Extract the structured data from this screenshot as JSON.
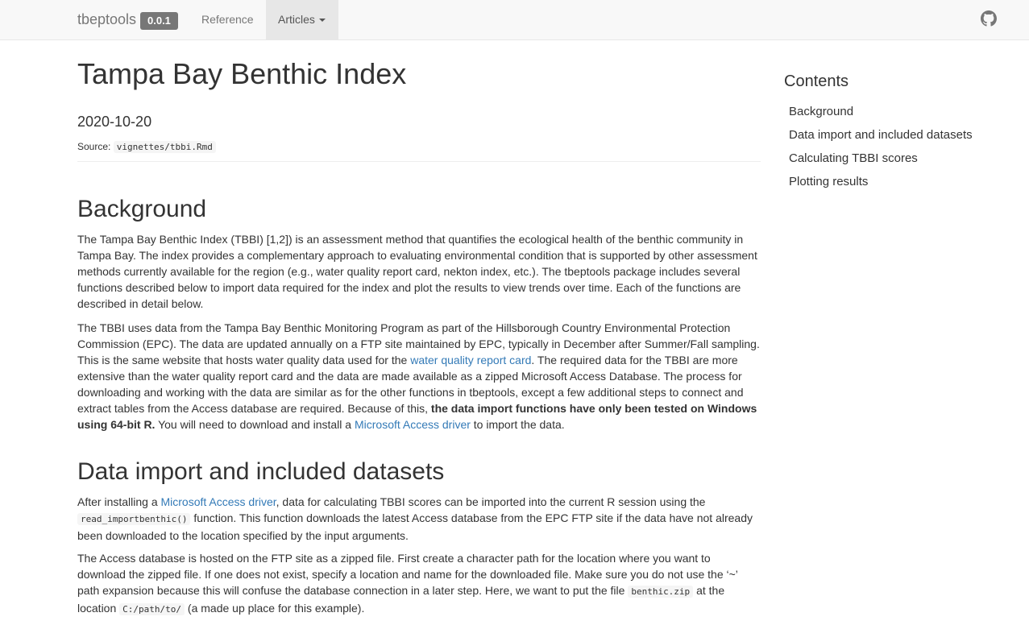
{
  "navbar": {
    "brand": "tbeptools",
    "version": "0.0.1",
    "links": [
      {
        "label": "Reference"
      },
      {
        "label": "Articles"
      }
    ],
    "github_icon": "github-icon"
  },
  "article": {
    "title": "Tampa Bay Benthic Index",
    "date": "2020-10-20",
    "source_label": "Source:",
    "source_file": "vignettes/tbbi.Rmd"
  },
  "background": {
    "heading": "Background",
    "p1": "The Tampa Bay Benthic Index (TBBI) [1,2]) is an assessment method that quantifies the ecological health of the benthic community in Tampa Bay. The index provides a complementary approach to evaluating environmental condition that is supported by other assessment methods currently available for the region (e.g., water quality report card, nekton index, etc.). The tbeptools package includes several functions described below to import data required for the index and plot the results to view trends over time. Each of the functions are described in detail below.",
    "p2_a": "The TBBI uses data from the Tampa Bay Benthic Monitoring Program as part of the Hillsborough Country Environmental Protection Commission (EPC). The data are updated annually on a FTP site maintained by EPC, typically in December after Summer/Fall sampling. This is the same website that hosts water quality data used for the ",
    "p2_link": "water quality report card",
    "p2_b": ". The required data for the TBBI are more extensive than the water quality report card and the data are made available as a zipped Microsoft Access Database. The process for downloading and working with the data are similar as for the other functions in tbeptools, except a few additional steps to connect and extract tables from the Access database are required. Because of this, ",
    "p2_bold": "the data import functions have only been tested on Windows using 64-bit R.",
    "p2_c": " You will need to download and install a ",
    "p2_link2": "Microsoft Access driver",
    "p2_d": " to import the data."
  },
  "data_import": {
    "heading": "Data import and included datasets",
    "p3_a": "After installing a ",
    "p3_link": "Microsoft Access driver",
    "p3_b": ", data for calculating TBBI scores can be imported into the current R session using the ",
    "p3_code": "read_importbenthic()",
    "p3_c": " function. This function downloads the latest Access database from the EPC FTP site if the data have not already been downloaded to the location specified by the input arguments.",
    "p4_a": "The Access database is hosted on the FTP site as a zipped file. First create a character path for the location where you want to download the zipped file. If one does not exist, specify a location and name for the downloaded file. Make sure you do not use the ‘~’ path expansion because this will confuse the database connection in a later step. Here, we want to put the file ",
    "p4_code1": "benthic.zip",
    "p4_b": " at the location ",
    "p4_code2": "C:/path/to/",
    "p4_c": " (a made up place for this example)."
  },
  "toc": {
    "title": "Contents",
    "items": [
      {
        "label": "Background"
      },
      {
        "label": "Data import and included datasets"
      },
      {
        "label": "Calculating TBBI scores"
      },
      {
        "label": "Plotting results"
      }
    ]
  }
}
